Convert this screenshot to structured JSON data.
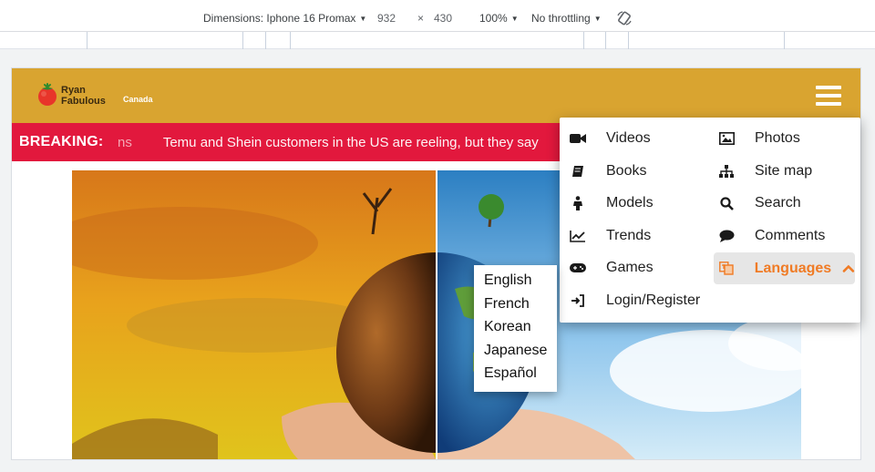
{
  "devtools": {
    "dimensions_label": "Dimensions: Iphone 16 Promax",
    "width": "932",
    "times": "×",
    "height": "430",
    "zoom": "100%",
    "throttling": "No throttling"
  },
  "site": {
    "logo_line1": "Ryan",
    "logo_line2": "Fabulous",
    "region": "Canada",
    "breaking_label": "BREAKING:",
    "ticker_prev": "ns",
    "ticker_text": "Temu and Shein customers in the US are reeling, but they say"
  },
  "menu": {
    "left": [
      {
        "label": "Videos",
        "icon": "video-icon"
      },
      {
        "label": "Books",
        "icon": "book-icon"
      },
      {
        "label": "Models",
        "icon": "person-icon"
      },
      {
        "label": "Trends",
        "icon": "trend-chart-icon"
      },
      {
        "label": "Games",
        "icon": "gamepad-icon"
      },
      {
        "label": "Login/Register",
        "icon": "login-icon"
      }
    ],
    "right": [
      {
        "label": "Photos",
        "icon": "image-icon"
      },
      {
        "label": "Site map",
        "icon": "sitemap-icon"
      },
      {
        "label": "Search",
        "icon": "search-icon"
      },
      {
        "label": "Comments",
        "icon": "comment-icon"
      },
      {
        "label": "Languages",
        "icon": "translate-icon"
      }
    ]
  },
  "languages": [
    "English",
    "French",
    "Korean",
    "Japanese",
    "Español"
  ],
  "colors": {
    "header": "#d9a430",
    "breaking": "#e2183d",
    "accent": "#f07b25"
  }
}
